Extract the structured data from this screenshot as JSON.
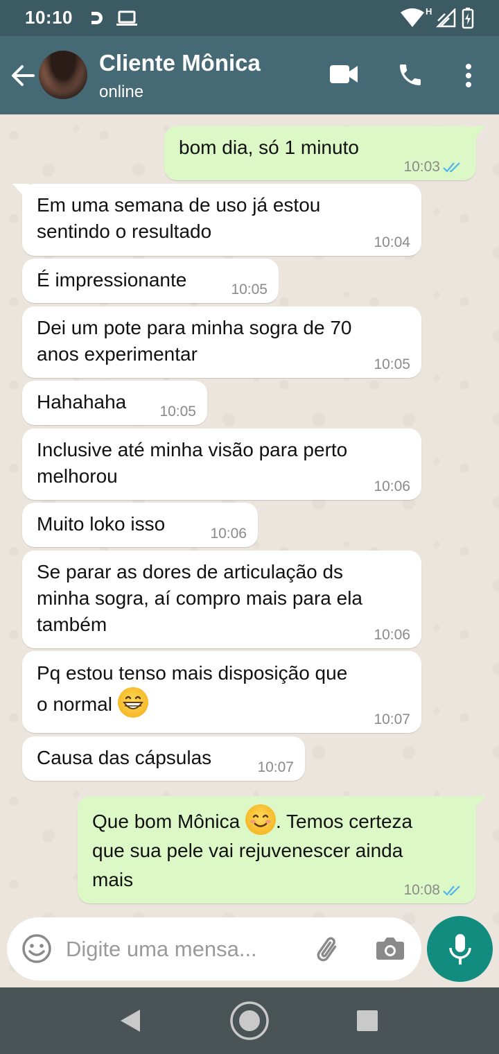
{
  "status_bar": {
    "time": "10:10",
    "network_label": "H"
  },
  "header": {
    "contact_name": "Cliente Mônica",
    "contact_status": "online"
  },
  "messages": [
    {
      "dir": "out",
      "text": "bom dia, só 1 minuto",
      "time": "10:03"
    },
    {
      "dir": "in",
      "text": "Em uma semana de uso já estou\nsentindo o resultado",
      "time": "10:04"
    },
    {
      "dir": "in",
      "text": "É impressionante",
      "time": "10:05"
    },
    {
      "dir": "in",
      "text": "Dei um pote para minha sogra de 70\nanos experimentar",
      "time": "10:05"
    },
    {
      "dir": "in",
      "text": "Hahahaha",
      "time": "10:05"
    },
    {
      "dir": "in",
      "text": "Inclusive até minha visão para perto\nmelhorou",
      "time": "10:06"
    },
    {
      "dir": "in",
      "text": "Muito loko isso",
      "time": "10:06"
    },
    {
      "dir": "in",
      "text": "Se parar as dores de articulação ds\nminha sogra, aí compro mais para ela\ntambém",
      "time": "10:06"
    },
    {
      "dir": "in",
      "text_before": "Pq estou tenso mais disposição que\no normal",
      "emoji": "grinning-face-emoji",
      "time": "10:07"
    },
    {
      "dir": "in",
      "text": "Causa das cápsulas",
      "time": "10:07"
    },
    {
      "dir": "out",
      "text_before": "Que bom Mônica",
      "emoji": "smiling-face-emoji",
      "text_after": ". Temos certeza\nque sua pele vai rejuvenescer ainda\nmais",
      "time": "10:08"
    }
  ],
  "composer": {
    "placeholder": "Digite uma mensa..."
  },
  "colors": {
    "header": "#466a75",
    "status_bar": "#3c5a64",
    "outgoing_bubble": "#dcf8c6",
    "incoming_bubble": "#ffffff",
    "mic_button": "#128c7e",
    "read_ticks": "#4fb6ec"
  },
  "icons": [
    "back-arrow-icon",
    "video-call-icon",
    "phone-icon",
    "more-vert-icon",
    "emoji-icon",
    "attach-icon",
    "camera-icon",
    "mic-icon",
    "double-check-icon"
  ]
}
